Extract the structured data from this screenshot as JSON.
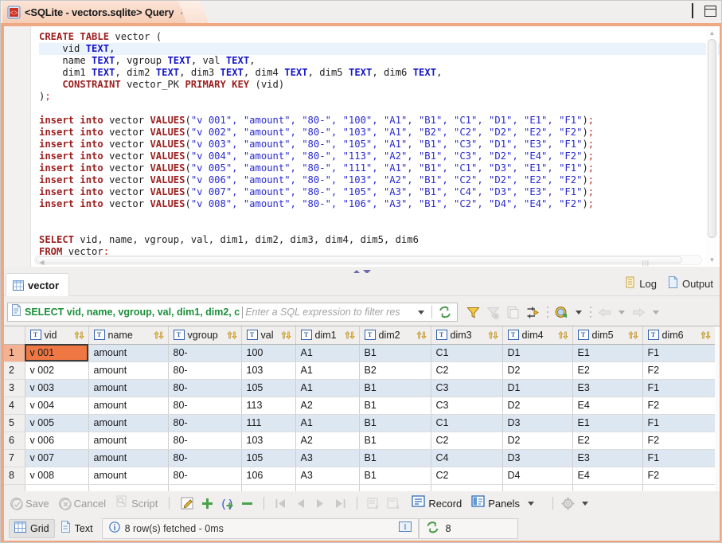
{
  "window": {
    "title": "<SQLite - vectors.sqlite> Query",
    "close_label": "⌧",
    "minimize_label": "minimize",
    "maximize_label": "maximize"
  },
  "editor": {
    "lines": [
      [
        {
          "t": "CREATE TABLE ",
          "c": "kw"
        },
        {
          "t": "vector (",
          "c": "pln"
        }
      ],
      [
        {
          "t": "    vid ",
          "c": "pln"
        },
        {
          "t": "TEXT",
          "c": "kwb"
        },
        {
          "t": ",",
          "c": "pln"
        }
      ],
      [
        {
          "t": "    name ",
          "c": "pln"
        },
        {
          "t": "TEXT",
          "c": "kwb"
        },
        {
          "t": ", vgroup ",
          "c": "pln"
        },
        {
          "t": "TEXT",
          "c": "kwb"
        },
        {
          "t": ", val ",
          "c": "pln"
        },
        {
          "t": "TEXT",
          "c": "kwb"
        },
        {
          "t": ",",
          "c": "pln"
        }
      ],
      [
        {
          "t": "    dim1 ",
          "c": "pln"
        },
        {
          "t": "TEXT",
          "c": "kwb"
        },
        {
          "t": ", dim2 ",
          "c": "pln"
        },
        {
          "t": "TEXT",
          "c": "kwb"
        },
        {
          "t": ", dim3 ",
          "c": "pln"
        },
        {
          "t": "TEXT",
          "c": "kwb"
        },
        {
          "t": ", dim4 ",
          "c": "pln"
        },
        {
          "t": "TEXT",
          "c": "kwb"
        },
        {
          "t": ", dim5 ",
          "c": "pln"
        },
        {
          "t": "TEXT",
          "c": "kwb"
        },
        {
          "t": ", dim6 ",
          "c": "pln"
        },
        {
          "t": "TEXT",
          "c": "kwb"
        },
        {
          "t": ",",
          "c": "pln"
        }
      ],
      [
        {
          "t": "    CONSTRAINT ",
          "c": "kw"
        },
        {
          "t": "vector_PK ",
          "c": "pln"
        },
        {
          "t": "PRIMARY KEY ",
          "c": "kw"
        },
        {
          "t": "(vid)",
          "c": "pln"
        }
      ],
      [
        {
          "t": ")",
          "c": "pln"
        },
        {
          "t": ";",
          "c": "pun"
        }
      ],
      [],
      [
        {
          "t": "insert into ",
          "c": "kw"
        },
        {
          "t": "vector ",
          "c": "pln"
        },
        {
          "t": "VALUES",
          "c": "kw"
        },
        {
          "t": "(",
          "c": "pln"
        },
        {
          "t": "\"v 001\", \"amount\", \"80-\", \"100\", \"A1\", \"B1\", \"C1\", \"D1\", \"E1\", \"F1\"",
          "c": "str"
        },
        {
          "t": ")",
          "c": "pln"
        },
        {
          "t": ";",
          "c": "pun"
        }
      ],
      [
        {
          "t": "insert into ",
          "c": "kw"
        },
        {
          "t": "vector ",
          "c": "pln"
        },
        {
          "t": "VALUES",
          "c": "kw"
        },
        {
          "t": "(",
          "c": "pln"
        },
        {
          "t": "\"v 002\", \"amount\", \"80-\", \"103\", \"A1\", \"B2\", \"C2\", \"D2\", \"E2\", \"F2\"",
          "c": "str"
        },
        {
          "t": ")",
          "c": "pln"
        },
        {
          "t": ";",
          "c": "pun"
        }
      ],
      [
        {
          "t": "insert into ",
          "c": "kw"
        },
        {
          "t": "vector ",
          "c": "pln"
        },
        {
          "t": "VALUES",
          "c": "kw"
        },
        {
          "t": "(",
          "c": "pln"
        },
        {
          "t": "\"v 003\", \"amount\", \"80-\", \"105\", \"A1\", \"B1\", \"C3\", \"D1\", \"E3\", \"F1\"",
          "c": "str"
        },
        {
          "t": ")",
          "c": "pln"
        },
        {
          "t": ";",
          "c": "pun"
        }
      ],
      [
        {
          "t": "insert into ",
          "c": "kw"
        },
        {
          "t": "vector ",
          "c": "pln"
        },
        {
          "t": "VALUES",
          "c": "kw"
        },
        {
          "t": "(",
          "c": "pln"
        },
        {
          "t": "\"v 004\", \"amount\", \"80-\", \"113\", \"A2\", \"B1\", \"C3\", \"D2\", \"E4\", \"F2\"",
          "c": "str"
        },
        {
          "t": ")",
          "c": "pln"
        },
        {
          "t": ";",
          "c": "pun"
        }
      ],
      [
        {
          "t": "insert into ",
          "c": "kw"
        },
        {
          "t": "vector ",
          "c": "pln"
        },
        {
          "t": "VALUES",
          "c": "kw"
        },
        {
          "t": "(",
          "c": "pln"
        },
        {
          "t": "\"v 005\", \"amount\", \"80-\", \"111\", \"A1\", \"B1\", \"C1\", \"D3\", \"E1\", \"F1\"",
          "c": "str"
        },
        {
          "t": ")",
          "c": "pln"
        },
        {
          "t": ";",
          "c": "pun"
        }
      ],
      [
        {
          "t": "insert into ",
          "c": "kw"
        },
        {
          "t": "vector ",
          "c": "pln"
        },
        {
          "t": "VALUES",
          "c": "kw"
        },
        {
          "t": "(",
          "c": "pln"
        },
        {
          "t": "\"v 006\", \"amount\", \"80-\", \"103\", \"A2\", \"B1\", \"C2\", \"D2\", \"E2\", \"F2\"",
          "c": "str"
        },
        {
          "t": ")",
          "c": "pln"
        },
        {
          "t": ";",
          "c": "pun"
        }
      ],
      [
        {
          "t": "insert into ",
          "c": "kw"
        },
        {
          "t": "vector ",
          "c": "pln"
        },
        {
          "t": "VALUES",
          "c": "kw"
        },
        {
          "t": "(",
          "c": "pln"
        },
        {
          "t": "\"v 007\", \"amount\", \"80-\", \"105\", \"A3\", \"B1\", \"C4\", \"D3\", \"E3\", \"F1\"",
          "c": "str"
        },
        {
          "t": ")",
          "c": "pln"
        },
        {
          "t": ";",
          "c": "pun"
        }
      ],
      [
        {
          "t": "insert into ",
          "c": "kw"
        },
        {
          "t": "vector ",
          "c": "pln"
        },
        {
          "t": "VALUES",
          "c": "kw"
        },
        {
          "t": "(",
          "c": "pln"
        },
        {
          "t": "\"v 008\", \"amount\", \"80-\", \"106\", \"A3\", \"B1\", \"C2\", \"D4\", \"E4\", \"F2\"",
          "c": "str"
        },
        {
          "t": ")",
          "c": "pln"
        },
        {
          "t": ";",
          "c": "pun"
        }
      ],
      [],
      [],
      [
        {
          "t": "SELECT ",
          "c": "kw"
        },
        {
          "t": "vid, name, vgroup, val, dim1, dim2, dim3, dim4, dim5, dim6",
          "c": "pln"
        }
      ],
      [
        {
          "t": "FROM ",
          "c": "kw"
        },
        {
          "t": "vector",
          "c": "pln"
        },
        {
          "t": ";",
          "c": "pun"
        }
      ]
    ],
    "highlight_line_index": 1
  },
  "results_tab": {
    "label": "vector",
    "log_label": "Log",
    "output_label": "Output"
  },
  "filter_bar": {
    "sql_text": "SELECT vid, name, vgroup, val, dim1, dim2, c",
    "placeholder": "Enter a SQL expression to filter res",
    "icons": [
      "filter-icon",
      "filter-clear-icon",
      "copy-icon",
      "transform-icon",
      "refresh-data-icon",
      "back-icon",
      "forward-icon"
    ]
  },
  "grid": {
    "columns": [
      {
        "name": "vid",
        "type_icon": "T",
        "selected": true
      },
      {
        "name": "name",
        "type_icon": "T",
        "selected": false
      },
      {
        "name": "vgroup",
        "type_icon": "T",
        "selected": false
      },
      {
        "name": "val",
        "type_icon": "T",
        "selected": false
      },
      {
        "name": "dim1",
        "type_icon": "T",
        "selected": false
      },
      {
        "name": "dim2",
        "type_icon": "T",
        "selected": false
      },
      {
        "name": "dim3",
        "type_icon": "T",
        "selected": false
      },
      {
        "name": "dim4",
        "type_icon": "T",
        "selected": false
      },
      {
        "name": "dim5",
        "type_icon": "T",
        "selected": false
      },
      {
        "name": "dim6",
        "type_icon": "T",
        "selected": false
      }
    ],
    "rows": [
      {
        "n": "1",
        "cells": [
          "v 001",
          "amount",
          "80-",
          "100",
          "A1",
          "B1",
          "C1",
          "D1",
          "E1",
          "F1"
        ]
      },
      {
        "n": "2",
        "cells": [
          "v 002",
          "amount",
          "80-",
          "103",
          "A1",
          "B2",
          "C2",
          "D2",
          "E2",
          "F2"
        ]
      },
      {
        "n": "3",
        "cells": [
          "v 003",
          "amount",
          "80-",
          "105",
          "A1",
          "B1",
          "C3",
          "D1",
          "E3",
          "F1"
        ]
      },
      {
        "n": "4",
        "cells": [
          "v 004",
          "amount",
          "80-",
          "113",
          "A2",
          "B1",
          "C3",
          "D2",
          "E4",
          "F2"
        ]
      },
      {
        "n": "5",
        "cells": [
          "v 005",
          "amount",
          "80-",
          "111",
          "A1",
          "B1",
          "C1",
          "D3",
          "E1",
          "F1"
        ]
      },
      {
        "n": "6",
        "cells": [
          "v 006",
          "amount",
          "80-",
          "103",
          "A2",
          "B1",
          "C2",
          "D2",
          "E2",
          "F2"
        ]
      },
      {
        "n": "7",
        "cells": [
          "v 007",
          "amount",
          "80-",
          "105",
          "A3",
          "B1",
          "C4",
          "D3",
          "E3",
          "F1"
        ]
      },
      {
        "n": "8",
        "cells": [
          "v 008",
          "amount",
          "80-",
          "106",
          "A3",
          "B1",
          "C2",
          "D4",
          "E4",
          "F2"
        ]
      }
    ],
    "selected_row": 0,
    "selected_col": 0
  },
  "bottom_toolbar": {
    "save_label": "Save",
    "cancel_label": "Cancel",
    "script_label": "Script",
    "record_label": "Record",
    "panels_label": "Panels",
    "icons": [
      "edit-icon",
      "add-row-icon",
      "duplicate-row-icon",
      "delete-row-icon",
      "first-row-icon",
      "prev-row-icon",
      "next-row-icon",
      "last-row-icon",
      "export-icon",
      "import-icon",
      "settings-icon"
    ]
  },
  "statusbar": {
    "grid_label": "Grid",
    "text_label": "Text",
    "status_message": "8 row(s) fetched - 0ms",
    "fetch_count": "8"
  },
  "colors": {
    "accent": "#f0a882",
    "selection": "#ee7744",
    "row_alt": "#dde7f2",
    "header_selected": "#f5b293",
    "sql_green": "#1b8f3a",
    "keyword_red": "#9c1f1f",
    "type_blue": "#1414c8",
    "string_blue": "#2a2ad0"
  }
}
